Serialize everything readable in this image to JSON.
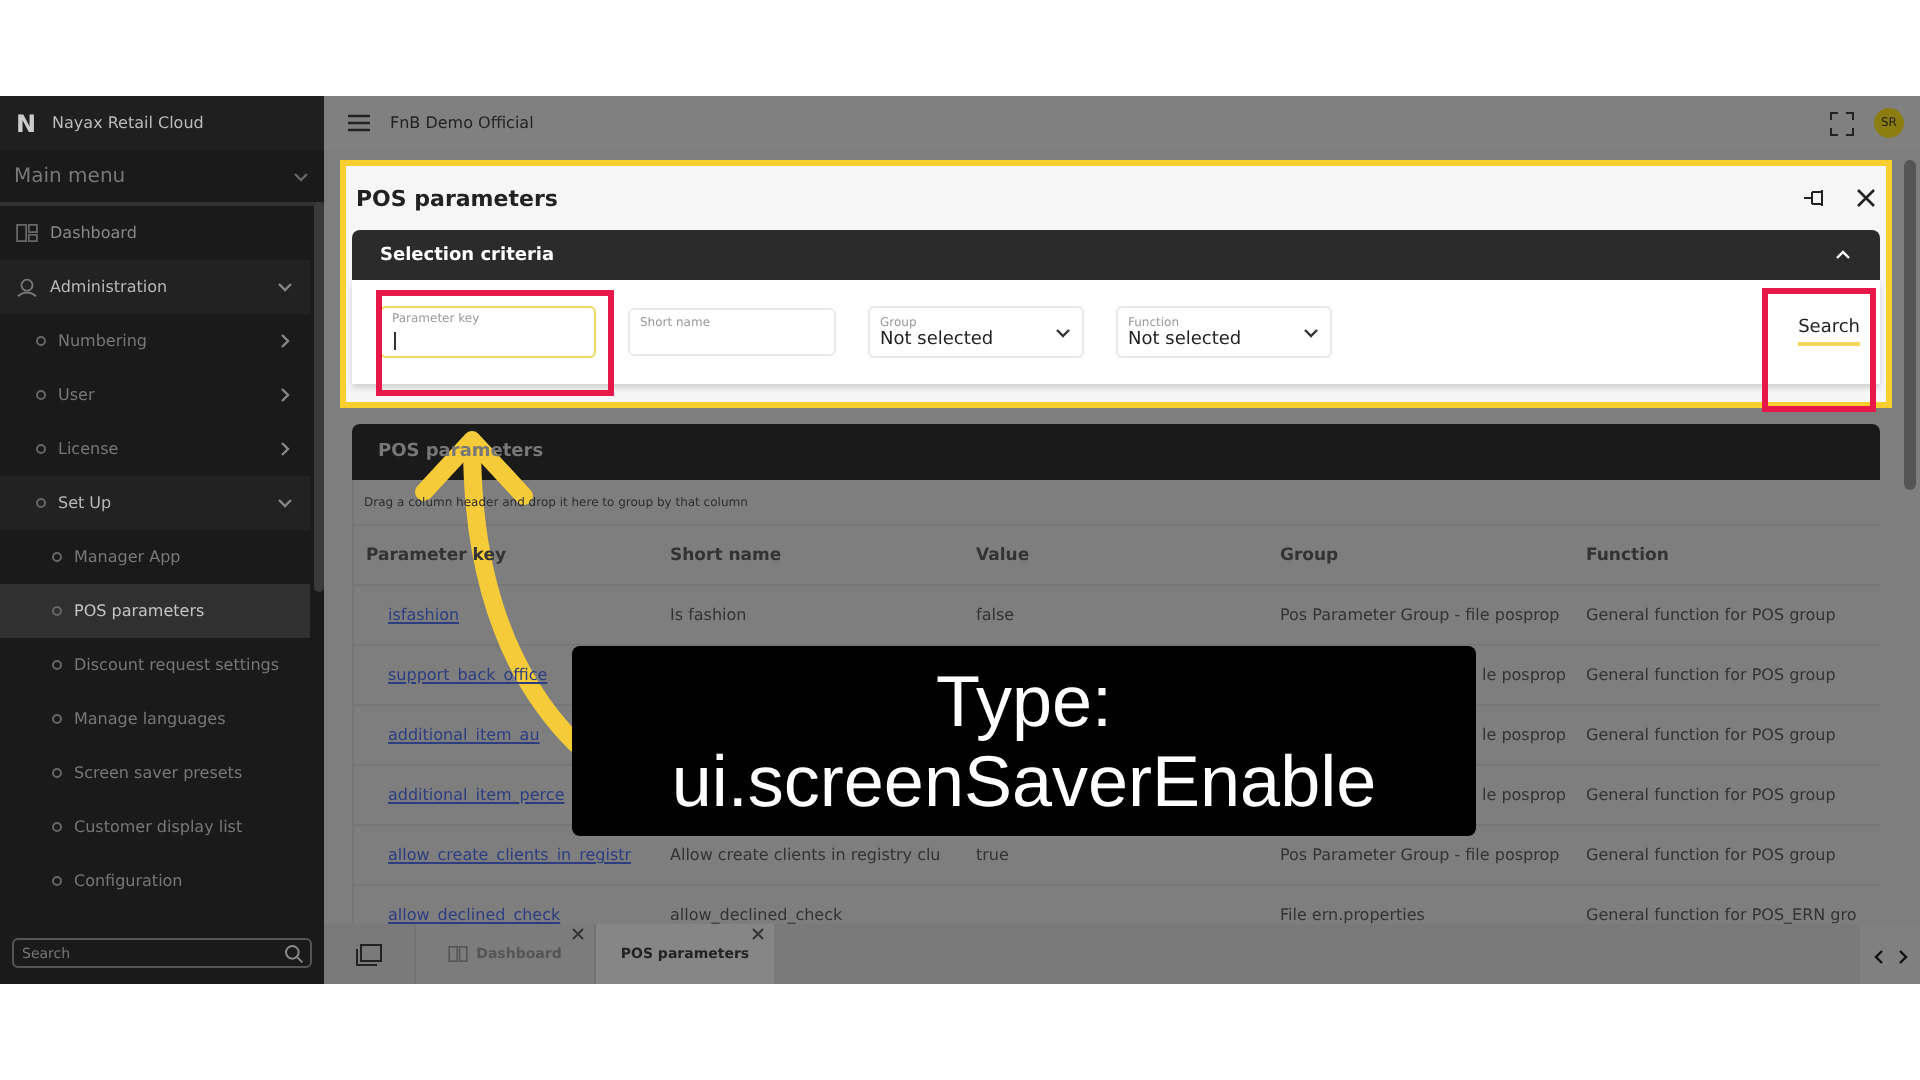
{
  "sidebar": {
    "logo": "N",
    "brand": "Nayax Retail Cloud",
    "menu_title": "Main menu",
    "items": [
      {
        "label": "Dashboard",
        "selected": false
      },
      {
        "label": "Administration",
        "selected": false,
        "expanded": true,
        "children": [
          {
            "label": "Numbering",
            "selected": false,
            "expanded": false
          },
          {
            "label": "User",
            "selected": false,
            "expanded": false
          },
          {
            "label": "License",
            "selected": false,
            "expanded": false
          },
          {
            "label": "Set Up",
            "selected": false,
            "expanded": true,
            "children": [
              {
                "label": "Manager App",
                "selected": false
              },
              {
                "label": "POS parameters",
                "selected": true
              },
              {
                "label": "Discount request settings",
                "selected": false
              },
              {
                "label": "Manage languages",
                "selected": false
              },
              {
                "label": "Screen saver presets",
                "selected": false
              },
              {
                "label": "Customer display list",
                "selected": false
              },
              {
                "label": "Configuration",
                "selected": false
              }
            ]
          }
        ]
      }
    ],
    "search": {
      "placeholder": "Search"
    }
  },
  "top_bar": {
    "title": "FnB Demo Official",
    "avatar": "SR"
  },
  "panel": {
    "title": "POS parameters",
    "criteria_title": "Selection criteria",
    "fields": [
      {
        "kind": "text",
        "label": "Parameter key",
        "focused": true
      },
      {
        "kind": "text",
        "placeholder": "Short name",
        "focused": false
      },
      {
        "kind": "select",
        "label": "Group",
        "value": "Not selected",
        "focused": false
      },
      {
        "kind": "select",
        "label": "Function",
        "value": "Not selected",
        "focused": false
      }
    ],
    "search_button": "Search"
  },
  "grid": {
    "title": "POS parameters",
    "group_hint": "Drag a column header and drop it here to group by that column",
    "columns": [
      "Parameter key",
      "Short name",
      "Value",
      "Group",
      "Function"
    ],
    "rows": [
      {
        "key": "isfashion",
        "short_name": "Is fashion",
        "value": "false",
        "group": "Pos Parameter Group - file posprop",
        "function": "General function for POS group"
      },
      {
        "key": "support_back_office",
        "group": "le posprop",
        "function": "General function for POS group"
      },
      {
        "key": "additional_item_au",
        "group": "le posprop",
        "function": "General function for POS group"
      },
      {
        "key": "additional_item_perce",
        "group": "le posprop",
        "function": "General function for POS group"
      },
      {
        "key": "allow_create_clients_in_registr",
        "short_name": "Allow create clients in registry clu",
        "value": "true",
        "group": "Pos Parameter Group - file posprop",
        "function": "General function for POS group"
      },
      {
        "key": "allow_declined_check",
        "short_name": "allow_declined_check",
        "group": "File ern.properties",
        "function": "General function for POS_ERN gro"
      }
    ]
  },
  "tabs": [
    {
      "label": "Dashboard",
      "selected": false
    },
    {
      "label": "POS parameters",
      "selected": true
    }
  ],
  "callout": {
    "lines": [
      "Type:",
      "ui.screenSaverEnable"
    ]
  }
}
